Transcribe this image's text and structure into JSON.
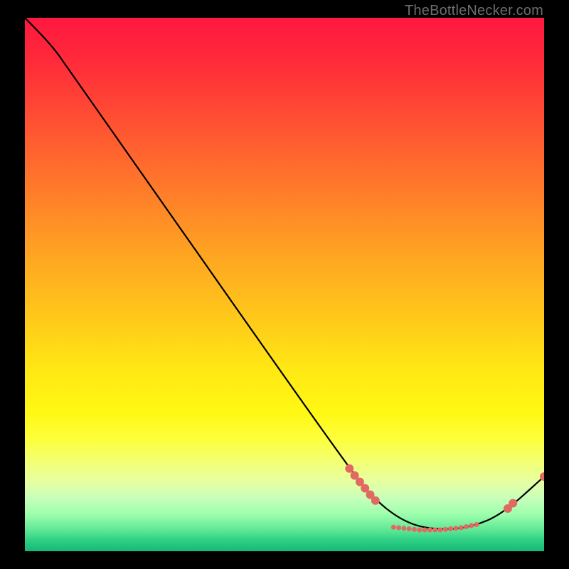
{
  "watermark": "TheBottleNecker.com",
  "chart_data": {
    "type": "line",
    "title": "",
    "xlabel": "",
    "ylabel": "",
    "xlim": [
      0,
      100
    ],
    "ylim": [
      0,
      100
    ],
    "background": {
      "kind": "vertical-gradient",
      "meaning": "bottleneck severity (red=high, green=low)",
      "stops": [
        {
          "pos": 0,
          "color": "#ff183f"
        },
        {
          "pos": 50,
          "color": "#ffd61a"
        },
        {
          "pos": 85,
          "color": "#f4ff72"
        },
        {
          "pos": 100,
          "color": "#18b877"
        }
      ]
    },
    "series": [
      {
        "name": "bottleneck-curve",
        "color": "#000000",
        "points": [
          {
            "x": 0,
            "y": 100
          },
          {
            "x": 5,
            "y": 95
          },
          {
            "x": 8,
            "y": 91
          },
          {
            "x": 62,
            "y": 16
          },
          {
            "x": 68,
            "y": 9
          },
          {
            "x": 74,
            "y": 5
          },
          {
            "x": 80,
            "y": 4
          },
          {
            "x": 86,
            "y": 4.5
          },
          {
            "x": 92,
            "y": 7
          },
          {
            "x": 100,
            "y": 14
          }
        ]
      }
    ],
    "markers": {
      "color": "#e06a62",
      "radius_main": 6,
      "radius_small": 3.5,
      "points": [
        {
          "x": 62.5,
          "y": 15.5,
          "r": "main"
        },
        {
          "x": 63.5,
          "y": 14.2,
          "r": "main"
        },
        {
          "x": 64.5,
          "y": 13.0,
          "r": "main"
        },
        {
          "x": 65.5,
          "y": 11.8,
          "r": "main"
        },
        {
          "x": 66.5,
          "y": 10.6,
          "r": "main"
        },
        {
          "x": 67.5,
          "y": 9.5,
          "r": "main"
        },
        {
          "x": 71.0,
          "y": 4.5,
          "r": "small"
        },
        {
          "x": 72.0,
          "y": 4.4,
          "r": "small"
        },
        {
          "x": 73.0,
          "y": 4.3,
          "r": "small"
        },
        {
          "x": 74.0,
          "y": 4.2,
          "r": "small"
        },
        {
          "x": 75.0,
          "y": 4.1,
          "r": "small"
        },
        {
          "x": 76.0,
          "y": 4.0,
          "r": "small"
        },
        {
          "x": 77.0,
          "y": 4.0,
          "r": "small"
        },
        {
          "x": 78.0,
          "y": 4.0,
          "r": "small"
        },
        {
          "x": 79.0,
          "y": 4.0,
          "r": "small"
        },
        {
          "x": 80.0,
          "y": 4.0,
          "r": "small"
        },
        {
          "x": 81.0,
          "y": 4.1,
          "r": "small"
        },
        {
          "x": 82.0,
          "y": 4.2,
          "r": "small"
        },
        {
          "x": 83.0,
          "y": 4.3,
          "r": "small"
        },
        {
          "x": 84.0,
          "y": 4.4,
          "r": "small"
        },
        {
          "x": 85.0,
          "y": 4.6,
          "r": "small"
        },
        {
          "x": 86.0,
          "y": 4.8,
          "r": "small"
        },
        {
          "x": 87.0,
          "y": 5.0,
          "r": "small"
        },
        {
          "x": 93.0,
          "y": 8.0,
          "r": "main"
        },
        {
          "x": 94.0,
          "y": 9.0,
          "r": "main"
        },
        {
          "x": 100.0,
          "y": 14.0,
          "r": "main"
        }
      ]
    }
  }
}
